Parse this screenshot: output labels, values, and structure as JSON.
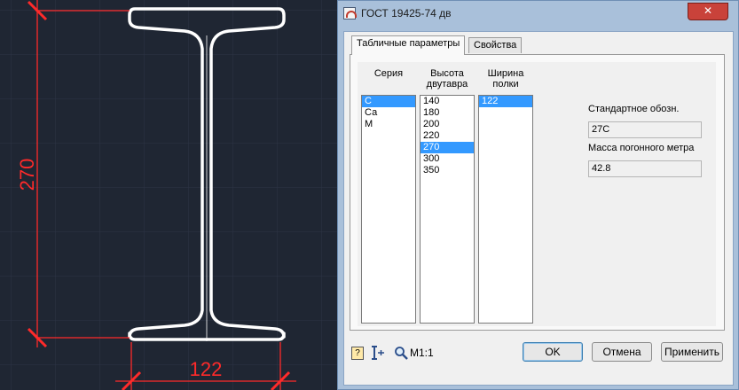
{
  "drawing": {
    "dimension_height": "270",
    "dimension_width": "122",
    "colors": {
      "background": "#1f2633",
      "grid": "#2a3140",
      "profile": "#ffffff",
      "dimension": "#ff2020"
    }
  },
  "dialog": {
    "title": "ГОСТ 19425-74 дв",
    "close_label": "✕",
    "tabs": [
      {
        "label": "Табличные параметры",
        "active": true
      },
      {
        "label": "Свойства",
        "active": false
      }
    ],
    "columns": {
      "series": {
        "header": "Серия",
        "items": [
          "С",
          "Са",
          "М"
        ],
        "selected": "С"
      },
      "height": {
        "header_line1": "Высота",
        "header_line2": "двутавра",
        "items": [
          "140",
          "180",
          "200",
          "220",
          "270",
          "300",
          "350"
        ],
        "selected": "270"
      },
      "flange": {
        "header_line1": "Ширина",
        "header_line2": "полки",
        "items": [
          "122"
        ],
        "selected": "122"
      }
    },
    "fields": {
      "standard_label": "Стандартное обозн.",
      "standard_value": "27С",
      "mass_label": "Масса погонного метра",
      "mass_value": "42.8"
    },
    "toolbar": {
      "help_icon": "help-icon",
      "insert_icon": "insert-point-icon",
      "zoom_icon": "magnifier-icon",
      "scale_label": "М1:1"
    },
    "buttons": {
      "ok": "OK",
      "cancel": "Отмена",
      "apply": "Применить"
    }
  }
}
